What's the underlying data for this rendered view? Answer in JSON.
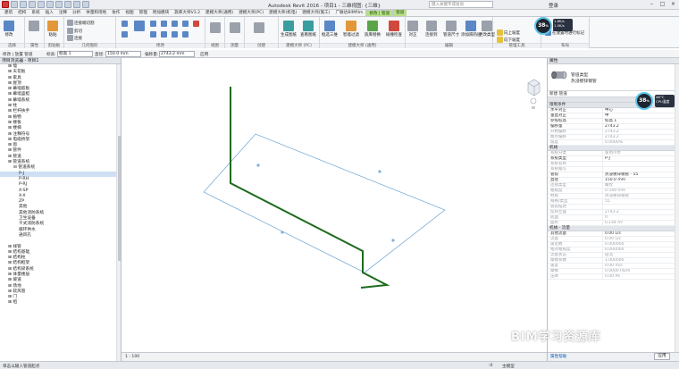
{
  "titlebar": {
    "title": "Autodesk Revit 2016 -   项目1 - 三维视图: {三维}",
    "search_placeholder": "键入关键字或短语",
    "login": "登录",
    "minimize": "–",
    "maximize": "□",
    "close": "×"
  },
  "tabs": [
    "建筑",
    "结构",
    "系统",
    "插入",
    "注释",
    "分析",
    "体量和场地",
    "协作",
    "视图",
    "管理",
    "附加模块",
    "族库大师V3.2",
    "建模大师(通用)",
    "建模大师(PC)",
    "建模大师(机电)",
    "建模大师(施工)",
    "广联达BIMfilm",
    "修改 | 管道",
    "管道"
  ],
  "ribbon": {
    "panels": [
      {
        "label": "选择"
      },
      {
        "label": "属性"
      },
      {
        "label": "剪贴板"
      },
      {
        "label": "几何图形"
      },
      {
        "label": "修改"
      },
      {
        "label": "视图"
      },
      {
        "label": "测量"
      },
      {
        "label": "创建"
      },
      {
        "label": "建模大师 (PC)"
      },
      {
        "label": "建模大师 (通用)"
      },
      {
        "label": "编辑"
      },
      {
        "label": "管理工具"
      },
      {
        "label": "布局"
      },
      {
        "label": "标记"
      }
    ],
    "buttons": {
      "modify": "修改",
      "paste": "粘贴",
      "connect_join": "连接端切割",
      "cut": "剪切",
      "join": "连接",
      "generate_drawing": "生成图纸",
      "view_drawing": "查看图纸",
      "align_3d": "框选三维",
      "classify_filter": "智能过滤",
      "family_replace": "族库替换",
      "smart_avoid": "碰撞检查",
      "align": "对正",
      "connect_into": "连接到",
      "edit_pipe": "管道尺寸",
      "add_insul": "添加隔热层",
      "change_type": "更改类型",
      "tag_on_place": "在放置时进行标记",
      "rise_up": "向上坡度",
      "rise_down": "向下坡度",
      "regroup": "继承高程",
      "inherit_size": "继承大小",
      "edit_pipe_label": "管段与尺寸"
    },
    "cpu": {
      "percent_top": "38",
      "pct_sign": "%",
      "rate1": "1.8K/s",
      "rate2": "1.5K/s",
      "percent_props": "38",
      "temp": "46°C",
      "cpu_label": "CPU温度"
    }
  },
  "optbar1": {
    "items": [
      "选择 ▾",
      "属性",
      "剪贴板",
      "几何图形",
      "修改",
      "视图",
      "测量",
      "创建"
    ]
  },
  "optbar2": {
    "context": "修改 | 放置 管道",
    "level_label": "标高:",
    "level_value": "标高 1",
    "diameter_label": "直径:",
    "diameter_value": "150.0 mm",
    "offset_label": "偏移量:",
    "offset_value": "2743.2 mm",
    "apply": "应用"
  },
  "browser": {
    "header": "项目浏览器 - 项目1",
    "rows": [
      {
        "text": "墙",
        "indent": 1,
        "sel": false
      },
      {
        "text": "天花板",
        "indent": 1,
        "sel": false
      },
      {
        "text": "家具",
        "indent": 1,
        "sel": false
      },
      {
        "text": "屋顶",
        "indent": 1,
        "sel": false
      },
      {
        "text": "幕墙嵌板",
        "indent": 1,
        "sel": false
      },
      {
        "text": "幕墙竖梃",
        "indent": 1,
        "sel": false
      },
      {
        "text": "幕墙系统",
        "indent": 1,
        "sel": false
      },
      {
        "text": "柱",
        "indent": 1,
        "sel": false
      },
      {
        "text": "栏杆扶手",
        "indent": 1,
        "sel": false
      },
      {
        "text": "植物",
        "indent": 1,
        "sel": false
      },
      {
        "text": "楼板",
        "indent": 1,
        "sel": false
      },
      {
        "text": "楼梯",
        "indent": 1,
        "sel": false
      },
      {
        "text": "注释符号",
        "indent": 1,
        "sel": false
      },
      {
        "text": "电缆桥架",
        "indent": 1,
        "sel": false
      },
      {
        "text": "窗",
        "indent": 1,
        "sel": false
      },
      {
        "text": "管件",
        "indent": 1,
        "sel": false
      },
      {
        "text": "管道",
        "indent": 1,
        "sel": false
      },
      {
        "text": "管道系统",
        "indent": 1,
        "sel": false
      },
      {
        "text": "管道系统",
        "indent": 2,
        "sel": false
      },
      {
        "text": "P-J",
        "indent": 3,
        "sel": true
      },
      {
        "text": "P-RH",
        "indent": 3,
        "sel": false
      },
      {
        "text": "P-RJ",
        "indent": 3,
        "sel": false
      },
      {
        "text": "X-SP",
        "indent": 3,
        "sel": false
      },
      {
        "text": "X-X",
        "indent": 3,
        "sel": false
      },
      {
        "text": "ZP",
        "indent": 3,
        "sel": false
      },
      {
        "text": "其他",
        "indent": 3,
        "sel": false
      },
      {
        "text": "其他消防系统",
        "indent": 3,
        "sel": false
      },
      {
        "text": "卫生设备",
        "indent": 3,
        "sel": false
      },
      {
        "text": "干式消防系统",
        "indent": 3,
        "sel": false
      },
      {
        "text": "循环供水",
        "indent": 3,
        "sel": false
      },
      {
        "text": "通风孔",
        "indent": 3,
        "sel": false
      },
      {
        "text": "",
        "indent": 0,
        "sel": false
      },
      {
        "text": "线管",
        "indent": 1,
        "sel": false
      },
      {
        "text": "结构基础",
        "indent": 1,
        "sel": false
      },
      {
        "text": "结构柱",
        "indent": 1,
        "sel": false
      },
      {
        "text": "结构框架",
        "indent": 1,
        "sel": false
      },
      {
        "text": "结构梁系统",
        "indent": 1,
        "sel": false
      },
      {
        "text": "体量楼层",
        "indent": 1,
        "sel": false
      },
      {
        "text": "坡道",
        "indent": 1,
        "sel": false
      },
      {
        "text": "场地",
        "indent": 1,
        "sel": false
      },
      {
        "text": "软风管",
        "indent": 1,
        "sel": false
      },
      {
        "text": "门",
        "indent": 1,
        "sel": false
      },
      {
        "text": "组",
        "indent": 1,
        "sel": false
      }
    ]
  },
  "props": {
    "header": "属性",
    "type_line1": "管道类型",
    "type_line2": "热浸镀锌钢管",
    "instance": "新建 管道",
    "edit_type": "编辑类型",
    "sections": [
      {
        "title": "限制条件",
        "rows": [
          {
            "k": "水平对正",
            "v": "中心",
            "dim": false
          },
          {
            "k": "垂直对正",
            "v": "中",
            "dim": false
          },
          {
            "k": "参照标高",
            "v": "标高 1",
            "dim": false
          },
          {
            "k": "偏移量",
            "v": "2743.2",
            "dim": false
          },
          {
            "k": "开始偏移",
            "v": "2743.2",
            "dim": true
          },
          {
            "k": "端点偏移",
            "v": "2743.2",
            "dim": true
          },
          {
            "k": "坡度",
            "v": "0.0000%",
            "dim": true
          }
        ]
      },
      {
        "title": "机械",
        "rows": [
          {
            "k": "系统分类",
            "v": "家用冷水",
            "dim": true
          },
          {
            "k": "系统类型",
            "v": "P-J",
            "dim": false
          },
          {
            "k": "系统名称",
            "v": "",
            "dim": true
          },
          {
            "k": "系统缩写",
            "v": "",
            "dim": true
          },
          {
            "k": "管段",
            "v": "热浸镀锌钢管 - 55",
            "dim": false
          },
          {
            "k": "直径",
            "v": "150.0 mm",
            "dim": false
          },
          {
            "k": "连接类型",
            "v": "螺纹",
            "dim": true
          },
          {
            "k": "粗糙度",
            "v": "0.549 mm",
            "dim": true
          },
          {
            "k": "材质",
            "v": "热浸镀锌钢管",
            "dim": true
          },
          {
            "k": "规格/类型",
            "v": "55",
            "dim": true
          },
          {
            "k": "管段描述",
            "v": "",
            "dim": true
          },
          {
            "k": "反转立面",
            "v": "2743.2",
            "dim": true
          },
          {
            "k": "底面",
            "v": "0",
            "dim": true
          },
          {
            "k": "面积",
            "v": "0.144 m²",
            "dim": true
          }
        ]
      },
      {
        "title": "机械 - 流量",
        "rows": [
          {
            "k": "其他流量",
            "v": "0.00 L/s",
            "dim": false
          },
          {
            "k": "流量",
            "v": "0.00 L/s",
            "dim": true
          },
          {
            "k": "雷诺数",
            "v": "0.000000",
            "dim": true
          },
          {
            "k": "相对粗糙度",
            "v": "0.000000",
            "dim": true
          },
          {
            "k": "流量状态",
            "v": "层流",
            "dim": true
          },
          {
            "k": "摩擦系数",
            "v": "1.000000",
            "dim": true
          },
          {
            "k": "速度",
            "v": "0.00 m/s",
            "dim": true
          },
          {
            "k": "摩擦",
            "v": "0.0000 Pa/m",
            "dim": true
          },
          {
            "k": "压降",
            "v": "0.00 Pa",
            "dim": true
          }
        ]
      }
    ],
    "help_link": "属性帮助",
    "apply": "应用"
  },
  "viewbar": {
    "scale": "1 : 100"
  },
  "status": {
    "text": "单击以输入管道起点",
    "main_model": "主模型",
    "zero": ":0"
  },
  "watermark": "BIM学习资源库",
  "colors": {
    "pipe": "#1d6b1d",
    "workplane": "#7fb0d8",
    "accent": "#3a78c4",
    "context_tab": "#b8e08a"
  }
}
